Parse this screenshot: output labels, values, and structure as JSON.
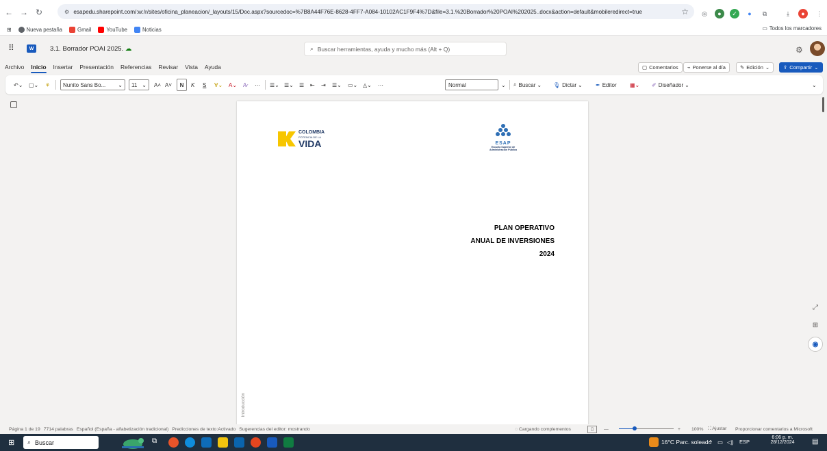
{
  "browser": {
    "url": "esapedu.sharepoint.com/:w:/r/sites/oficina_planeacion/_layouts/15/Doc.aspx?sourcedoc=%7B8A44F76E-8628-4FF7-A084-10102AC1F9F4%7D&file=3.1.%20Borrador%20POAI%202025..docx&action=default&mobileredirect=true",
    "bookmarks": [
      "Nueva pestaña",
      "Gmail",
      "YouTube",
      "Noticias"
    ],
    "all_bookmarks": "Todos los marcadores"
  },
  "app": {
    "doc_title": "3.1. Borrador POAI 2025.",
    "search_placeholder": "Buscar herramientas, ayuda y mucho más (Alt + Q)"
  },
  "ribbon": {
    "tabs": [
      "Archivo",
      "Inicio",
      "Insertar",
      "Presentación",
      "Referencias",
      "Revisar",
      "Vista",
      "Ayuda"
    ],
    "comments": "Comentarios",
    "catch_up": "Ponerse al día",
    "editing": "Edición",
    "share": "Compartir"
  },
  "toolbar": {
    "font": "Nunito Sans Bo...",
    "size": "11",
    "bold": "N",
    "italic": "K",
    "underline": "S",
    "style": "Normal",
    "find": "Buscar",
    "dictate": "Dictar",
    "editor": "Editor",
    "designer": "Diseñador"
  },
  "document": {
    "logo_left_line1": "COLOMBIA",
    "logo_left_line2": "POTENCIA DE LA",
    "logo_left_line3": "VIDA",
    "logo_right_name": "ESAP",
    "logo_right_sub1": "Escuela Superior de",
    "logo_right_sub2": "Administración Pública",
    "heading1": "PLAN OPERATIVO",
    "heading2": "ANUAL DE INVERSIONES",
    "heading3": "2024",
    "vertical_label": "Introducción"
  },
  "status": {
    "page": "Página 1 de 19",
    "words": "7714 palabras",
    "language": "Español (España - alfabetización tradicional)",
    "predictions": "Predicciones de texto:Activado",
    "suggestions": "Sugerencias del editor: mostrando",
    "loading": "Cargando complementos",
    "zoom": "100%",
    "fit": "Ajustar",
    "feedback": "Proporcionar comentarios a Microsoft"
  },
  "taskbar": {
    "search": "Buscar",
    "weather": "16°C Parc. soleado",
    "lang": "ESP",
    "time": "6:06 p. m.",
    "date": "28/12/2024"
  },
  "colors": {
    "word_blue": "#185abd",
    "taskbar": "#1f2f3f",
    "yellow": "#f7c600"
  }
}
